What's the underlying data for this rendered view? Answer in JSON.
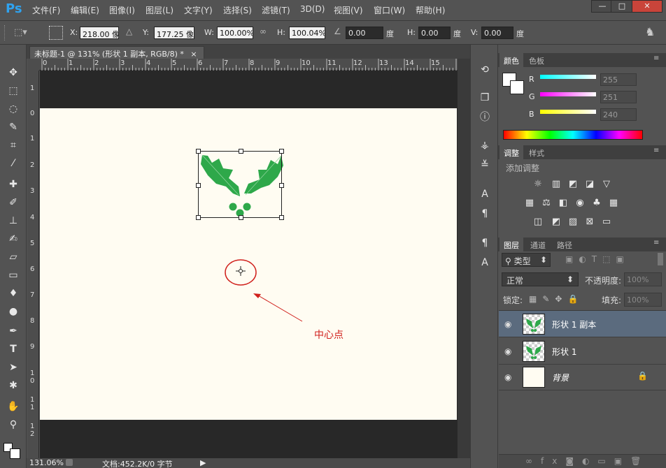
{
  "app": {
    "logo": "Ps"
  },
  "menu": [
    "文件(F)",
    "编辑(E)",
    "图像(I)",
    "图层(L)",
    "文字(Y)",
    "选择(S)",
    "滤镜(T)",
    "3D(D)",
    "视图(V)",
    "窗口(W)",
    "帮助(H)"
  ],
  "window_controls": {
    "minimize": "—",
    "maximize": "□",
    "close": "✕"
  },
  "options": {
    "x_label": "X:",
    "x_value": "218.00 像",
    "y_label": "Y:",
    "y_value": "177.25 像",
    "w_label": "W:",
    "w_value": "100.00%",
    "h_label": "H:",
    "h_value": "100.04%",
    "angle_value": "0.00",
    "angle_unit": "度",
    "hskew_label": "H:",
    "hskew_value": "0.00",
    "hskew_unit": "度",
    "vskew_label": "V:",
    "vskew_value": "0.00",
    "vskew_unit": "度"
  },
  "document": {
    "tab_title": "未标题-1 @ 131% (形状 1 副本, RGB/8) *",
    "tab_close": "×",
    "hruler_numbers": [
      "0",
      "1",
      "2",
      "3",
      "4",
      "5",
      "6",
      "7",
      "8",
      "9",
      "10",
      "11",
      "12",
      "13",
      "14",
      "15"
    ],
    "vruler_numbers": [
      "1",
      "0",
      "1",
      "2",
      "3",
      "4",
      "5",
      "6",
      "7",
      "8",
      "9",
      "1 0",
      "1 1",
      "1 2"
    ],
    "annotation_text": "中心点",
    "status_zoom": "131.06%",
    "status_doc": "文档:452.2K/0 字节"
  },
  "color_panel": {
    "tabs": [
      "颜色",
      "色板"
    ],
    "r_label": "R",
    "r_value": "255",
    "g_label": "G",
    "g_value": "251",
    "b_label": "B",
    "b_value": "240",
    "foreground": "#ffffff",
    "background": "#ffffff"
  },
  "adjust_panel": {
    "tabs": [
      "调整",
      "样式"
    ],
    "heading": "添加调整"
  },
  "layers_panel": {
    "tabs": [
      "图层",
      "通道",
      "路径"
    ],
    "filter_kind": "类型",
    "blend_mode": "正常",
    "opacity_label": "不透明度:",
    "opacity_value": "100%",
    "lock_label": "锁定:",
    "fill_label": "填充:",
    "fill_value": "100%",
    "layers": [
      {
        "name": "形状 1 副本",
        "selected": true
      },
      {
        "name": "形状 1",
        "selected": false
      },
      {
        "name": "背景",
        "selected": false
      }
    ]
  },
  "colors": {
    "canvas": "#fffcf2",
    "leaf_green": "#2ea84a",
    "annotation_red": "#d0201c"
  }
}
